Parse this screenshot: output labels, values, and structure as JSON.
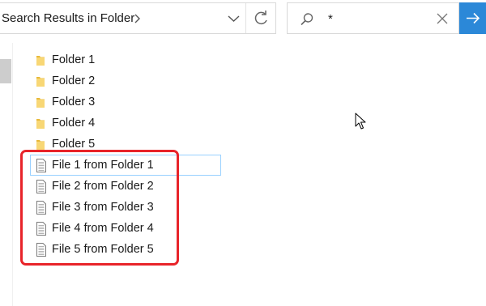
{
  "address_bar": {
    "path_text": "Search Results in Folder",
    "chevron_icon": "chevron-right-icon",
    "dropdown_icon": "chevron-down-icon",
    "refresh_icon": "refresh-icon"
  },
  "search": {
    "icon": "search-icon",
    "value": "*",
    "clear_icon": "close-icon",
    "go_icon": "arrow-right-icon",
    "go_color": "#2b88d8"
  },
  "items": [
    {
      "type": "folder",
      "label": "Folder 1"
    },
    {
      "type": "folder",
      "label": "Folder 2"
    },
    {
      "type": "folder",
      "label": "Folder 3"
    },
    {
      "type": "folder",
      "label": "Folder 4"
    },
    {
      "type": "folder",
      "label": "Folder 5"
    },
    {
      "type": "file",
      "label": "File 1 from Folder 1",
      "focused": true
    },
    {
      "type": "file",
      "label": "File 2 from Folder 2"
    },
    {
      "type": "file",
      "label": "File 3 from Folder 3"
    },
    {
      "type": "file",
      "label": "File 4 from Folder 4"
    },
    {
      "type": "file",
      "label": "File 5 from Folder 5"
    }
  ],
  "colors": {
    "highlight": "#e8242a",
    "focus_border": "#99d1ff",
    "folder": "#f8d775"
  }
}
